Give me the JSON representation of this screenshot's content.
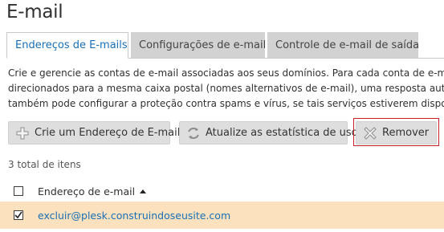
{
  "page": {
    "title": "E-mail"
  },
  "tabs": [
    {
      "label": "Endereços de E-mails",
      "active": true
    },
    {
      "label": "Configurações de e-mail",
      "active": false
    },
    {
      "label": "Controle de e-mail de saída",
      "active": false
    }
  ],
  "description": {
    "line1": "Crie e gerencie as contas de e-mail associadas aos seus domínios. Para cada conta de e-m",
    "line2": "direcionados para a mesma caixa postal (nomes alternativos de e-mail), uma resposta auto",
    "line3": "também pode configurar a proteção contra spams e vírus, se tais serviços estiverem dispo"
  },
  "toolbar": {
    "create_label": "Crie um Endereço de E-mail",
    "update_stats_label": "Atualize as estatística de uso",
    "remove_label": "Remover"
  },
  "list": {
    "total_label": "3 total de itens",
    "column_email": "Endereço de e-mail",
    "rows": [
      {
        "email": "excluir@plesk.construindoseusite.com",
        "checked": true
      }
    ]
  },
  "colors": {
    "link": "#1a6fb5",
    "selected_row": "#fbe1be",
    "highlight_border": "#c8202a"
  }
}
